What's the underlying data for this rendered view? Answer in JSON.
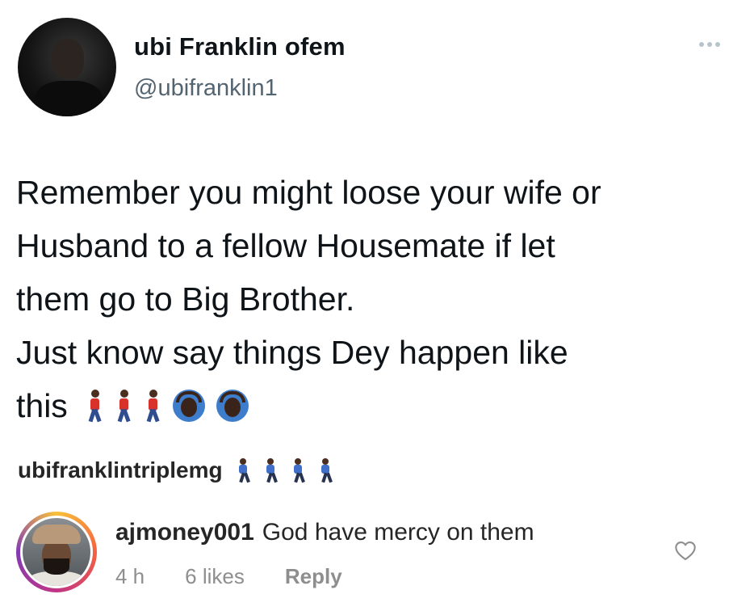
{
  "tweet": {
    "display_name": "ubi Franklin ofem",
    "handle": "@ubifranklin1",
    "text": "Remember you might loose your wife or\nHusband to a fellow Housemate if let\nthem go to Big Brother.\nJust know say things Dey happen like\nthis",
    "more_icon": "more-dots-icon",
    "emojis": [
      "walking-person",
      "walking-person",
      "walking-person",
      "person-gesturing-ok",
      "person-gesturing-ok"
    ]
  },
  "caption": {
    "username": "ubifranklintriplemg",
    "emojis": [
      "walking-person",
      "walking-person",
      "walking-person",
      "walking-person"
    ]
  },
  "comment": {
    "username": "ajmoney001",
    "text": "God have mercy on them",
    "time": "4 h",
    "likes": "6 likes",
    "reply_label": "Reply",
    "like_icon": "heart-icon"
  },
  "colors": {
    "text_primary": "#0f1419",
    "text_secondary": "#536471",
    "meta_gray": "#8e8e8e"
  }
}
